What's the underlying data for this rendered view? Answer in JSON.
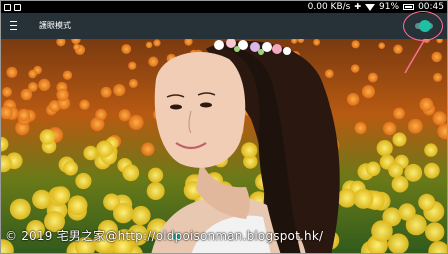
{
  "status_bar": {
    "network_speed": "0.00 KB/s",
    "battery": "91%",
    "time": "00:45",
    "icons": [
      "notification-icon",
      "gamepad-icon",
      "wifi-icon",
      "battery-icon"
    ]
  },
  "app_bar": {
    "title": "護眼模式",
    "background_color": "#263238",
    "toggle_color": "#1fbfa4",
    "toggle_on": true
  },
  "annotation": {
    "color": "#ff6f91"
  },
  "photo": {
    "description_icon": "photo-image"
  },
  "watermark": {
    "text": "© 2019 宅男之家@http://oldpoisonman.blogspot.hk/"
  }
}
